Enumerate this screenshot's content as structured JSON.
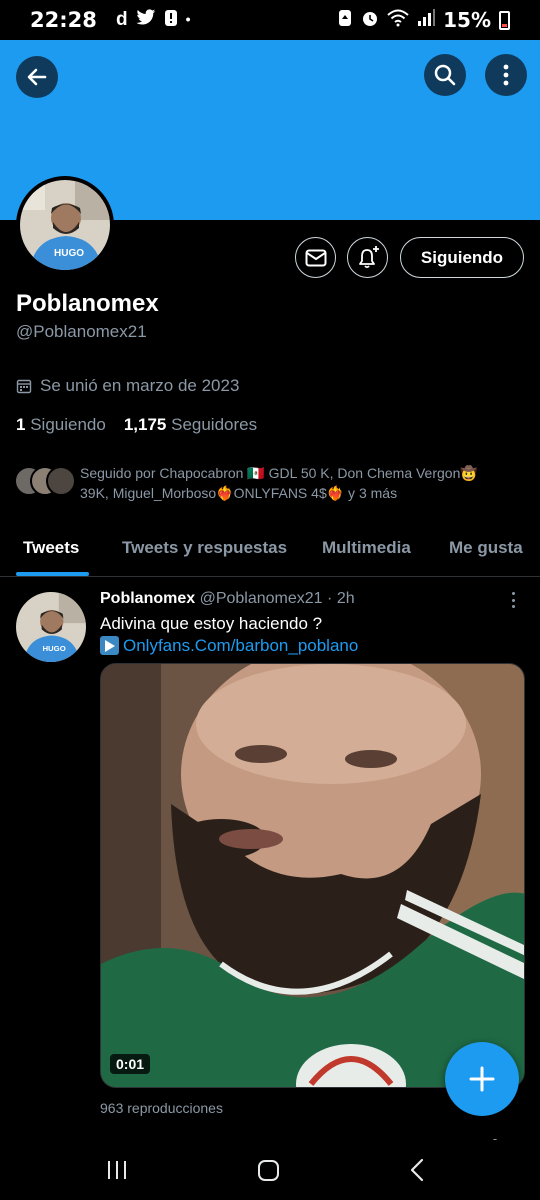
{
  "status_bar": {
    "time": "22:28",
    "battery_percent": "15%",
    "notification_icons": [
      "d-app-icon",
      "twitter-bird-icon",
      "alert-icon",
      "dot-icon"
    ],
    "system_icons": [
      "battery-saver-icon",
      "alarm-icon",
      "wifi-icon",
      "signal-icon",
      "battery-icon"
    ]
  },
  "colors": {
    "banner": "#1d9bf0",
    "accent": "#1d9bf0",
    "background": "#000000",
    "secondary_text": "#8b98a5"
  },
  "profile": {
    "name": "Poblanomex",
    "handle": "@Poblanomex21",
    "joined": "Se unió en marzo de 2023",
    "following_count": "1",
    "following_label": "Siguiendo",
    "followers_count": "1,175",
    "followers_label": "Seguidores",
    "follow_button": "Siguiendo",
    "followed_by_line1": "Seguido por Chapocabron 🇲🇽 GDL 50 K, Don Chema Vergon🤠",
    "followed_by_line2": "39K, Miguel_Morboso❤️‍🔥ONLYFANS 4$❤️‍🔥 y 3 más"
  },
  "tabs": [
    {
      "label": "Tweets",
      "active": true
    },
    {
      "label": "Tweets y respuestas",
      "active": false
    },
    {
      "label": "Multimedia",
      "active": false
    },
    {
      "label": "Me gusta",
      "active": false
    }
  ],
  "tweet": {
    "author_name": "Poblanomex",
    "author_handle": "@Poblanomex21",
    "time_ago": "2h",
    "separator": "·",
    "text": "Adivina que estoy haciendo ?",
    "link": "Onlyfans.Com/barbon_poblano",
    "video_duration": "0:01",
    "views": "963 reproducciones"
  }
}
